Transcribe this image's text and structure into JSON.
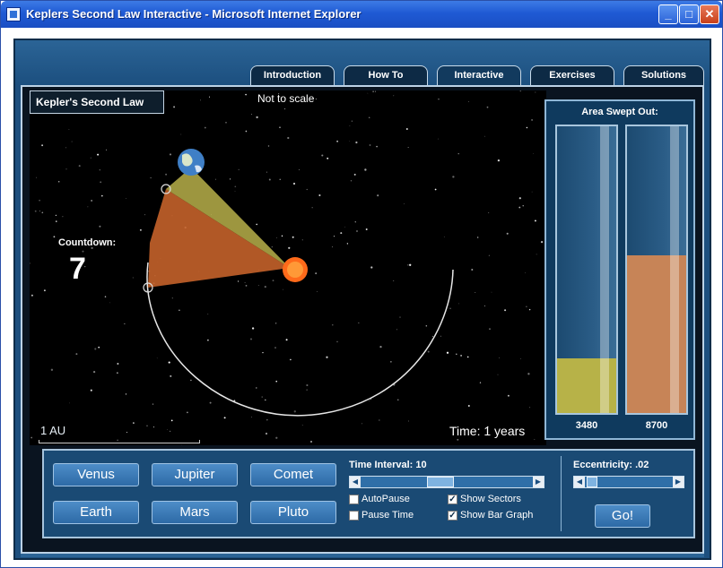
{
  "window": {
    "title": "Keplers Second Law Interactive - Microsoft Internet Explorer",
    "min_label": "_",
    "max_label": "□",
    "close_label": "✕"
  },
  "tabs": [
    {
      "label": "Introduction",
      "active": false
    },
    {
      "label": "How To",
      "active": false
    },
    {
      "label": "Interactive",
      "active": true
    },
    {
      "label": "Exercises",
      "active": false
    },
    {
      "label": "Solutions",
      "active": false
    }
  ],
  "sim": {
    "heading": "Kepler's Second Law",
    "scale_note": "Not to scale",
    "countdown_label": "Countdown:",
    "countdown_value": "7",
    "au_label": "1 AU",
    "time_label": "Time: 1 years",
    "colors": {
      "sector_yellow": "#b8b04a",
      "sector_orange": "#c4622a",
      "sun": "#ff6a1a",
      "orbit": "#e6e6e6"
    }
  },
  "graph": {
    "title": "Area Swept Out:",
    "bars": [
      {
        "value_label": "3480",
        "fill_fraction": 0.19,
        "color": "#b7b248"
      },
      {
        "value_label": "8700",
        "fill_fraction": 0.55,
        "color": "#c78457"
      }
    ]
  },
  "controls": {
    "bodies": [
      "Venus",
      "Jupiter",
      "Comet",
      "Earth",
      "Mars",
      "Pluto"
    ],
    "time_interval_label": "Time Interval: 10",
    "time_interval_fraction": 0.45,
    "checkboxes": [
      {
        "label": "AutoPause",
        "checked": false
      },
      {
        "label": "Show Sectors",
        "checked": true
      },
      {
        "label": "Pause Time",
        "checked": false
      },
      {
        "label": "Show Bar Graph",
        "checked": true
      }
    ],
    "eccentricity_label": "Eccentricity: .02",
    "eccentricity_fraction": 0.02,
    "go_label": "Go!"
  }
}
